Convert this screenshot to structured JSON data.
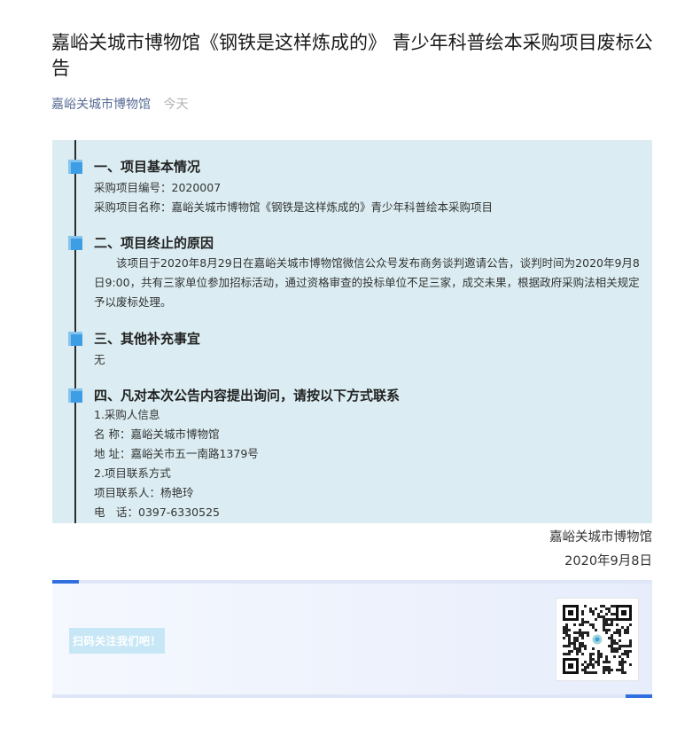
{
  "article": {
    "title": "嘉峪关城市博物馆《钢铁是这样炼成的》 青少年科普绘本采购项目废标公告",
    "source": "嘉峪关城市博物馆",
    "date": "今天"
  },
  "sections": [
    {
      "heading": "一、项目基本情况",
      "lines": [
        "采购项目编号：2020007",
        "采购项目名称：嘉峪关城市博物馆《钢铁是这样炼成的》青少年科普绘本采购项目"
      ]
    },
    {
      "heading": "二、项目终止的原因",
      "paragraph": "该项目于2020年8月29日在嘉峪关城市博物馆微信公众号发布商务谈判邀请公告，谈判时间为2020年9月8日9:00，共有三家单位参加招标活动，通过资格审查的投标单位不足三家，成交未果，根据政府采购法相关规定予以废标处理。"
    },
    {
      "heading": "三、其他补充事宜",
      "lines": [
        "无"
      ]
    },
    {
      "heading": "四、凡对本次公告内容提出询问，请按以下方式联系",
      "lines": [
        "1.采购人信息",
        "名 称：嘉峪关城市博物馆",
        "地 址：嘉峪关市五一南路1379号",
        "2.项目联系方式",
        "项目联系人：杨艳玲",
        "电　话：0397-6330525"
      ]
    }
  ],
  "signoff": {
    "org": "嘉峪关城市博物馆",
    "date": "2020年9月8日"
  },
  "footer": {
    "scan_label": "扫码关注我们吧！",
    "qr_icon": "qr-code-icon"
  },
  "colors": {
    "content_bg": "#dbedf2",
    "marker": "#3d9de5",
    "source_link": "#576b95",
    "footer_accent": "#2f6fe0"
  }
}
